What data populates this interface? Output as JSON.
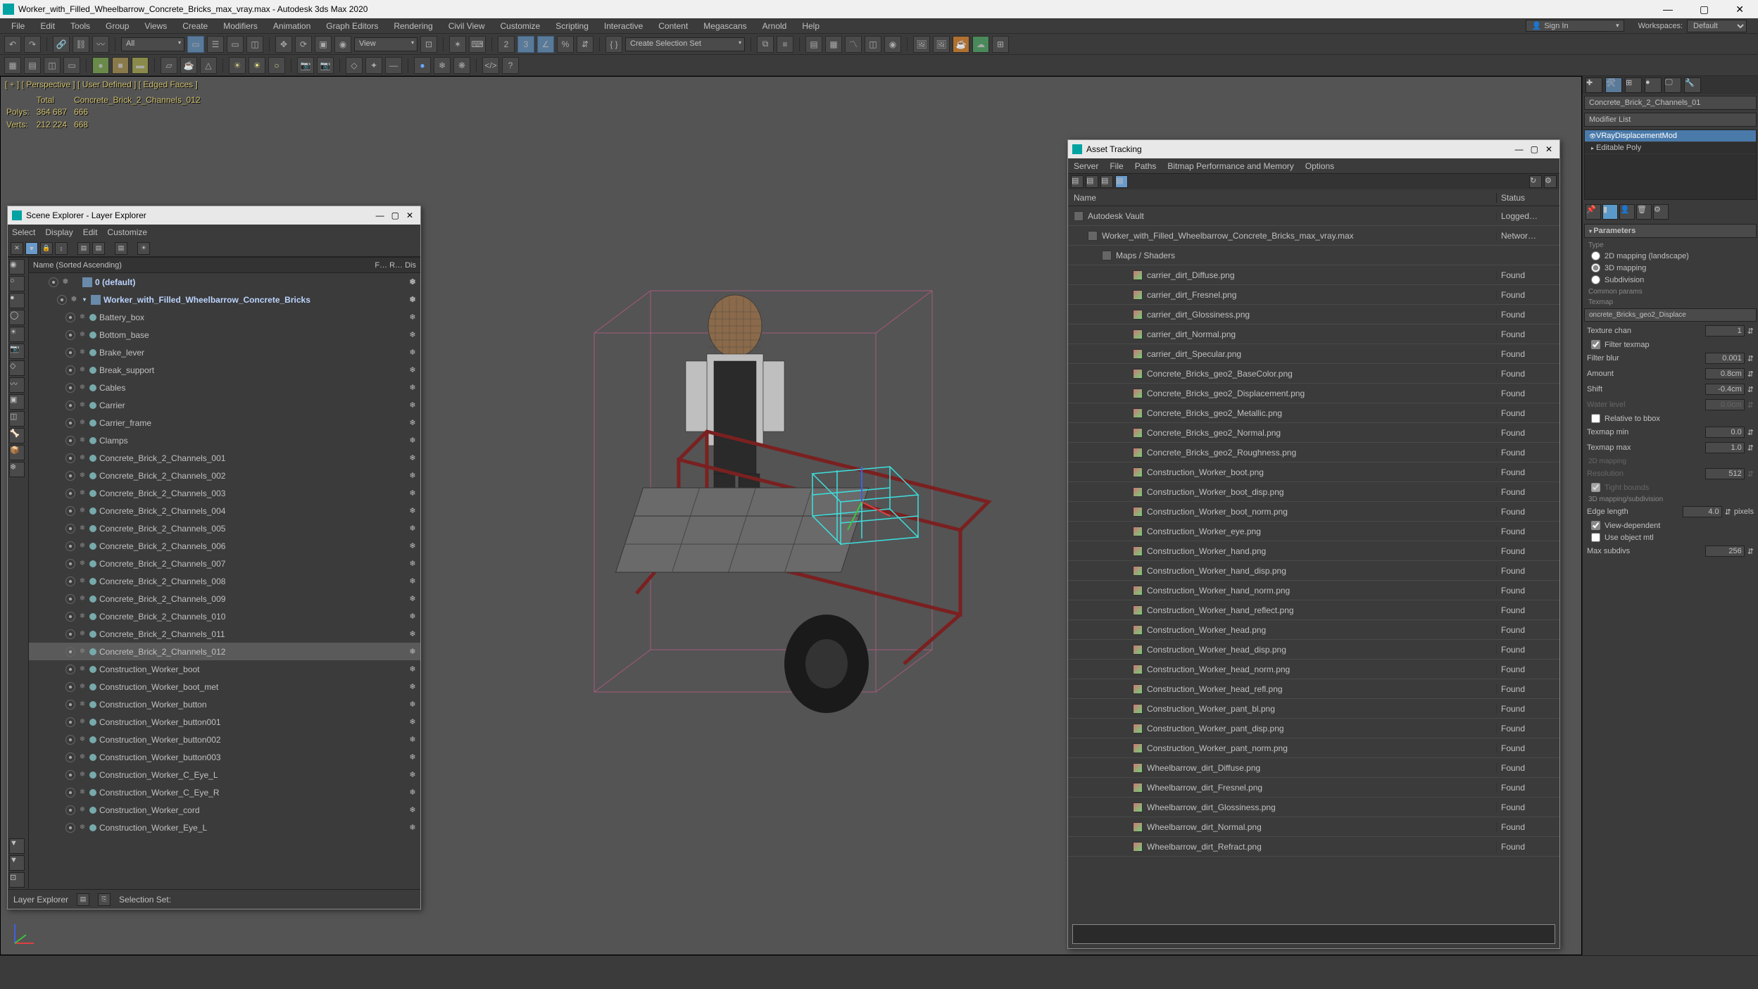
{
  "window": {
    "title": "Worker_with_Filled_Wheelbarrow_Concrete_Bricks_max_vray.max - Autodesk 3ds Max 2020",
    "min": "—",
    "max": "▢",
    "close": "✕"
  },
  "menu": [
    "File",
    "Edit",
    "Tools",
    "Group",
    "Views",
    "Create",
    "Modifiers",
    "Animation",
    "Graph Editors",
    "Rendering",
    "Civil View",
    "Customize",
    "Scripting",
    "Interactive",
    "Content",
    "Megascans",
    "Arnold",
    "Help"
  ],
  "sign_in": "Sign In",
  "workspace_label": "Workspaces:",
  "workspace_value": "Default",
  "sel_dropdown_1": "All",
  "sel_dropdown_2": "View",
  "sel_set_label": "Create Selection Set",
  "viewport": {
    "label": "[ + ] [ Perspective ] [ User Defined ] [ Edged Faces ]",
    "total_label": "Total",
    "obj_name": "Concrete_Brick_2_Channels_012",
    "polys_label": "Polys:",
    "polys_total": "364 687",
    "polys_sel": "666",
    "verts_label": "Verts:",
    "verts_total": "212 224",
    "verts_sel": "668"
  },
  "scene_explorer": {
    "title": "Scene Explorer - Layer Explorer",
    "menu": [
      "Select",
      "Display",
      "Edit",
      "Customize"
    ],
    "header_name": "Name (Sorted Ascending)",
    "header_cols": "F…   R…    Dis",
    "default_layer": "0 (default)",
    "main_layer": "Worker_with_Filled_Wheelbarrow_Concrete_Bricks",
    "objects": [
      "Battery_box",
      "Bottom_base",
      "Brake_lever",
      "Break_support",
      "Cables",
      "Carrier",
      "Carrier_frame",
      "Clamps",
      "Concrete_Brick_2_Channels_001",
      "Concrete_Brick_2_Channels_002",
      "Concrete_Brick_2_Channels_003",
      "Concrete_Brick_2_Channels_004",
      "Concrete_Brick_2_Channels_005",
      "Concrete_Brick_2_Channels_006",
      "Concrete_Brick_2_Channels_007",
      "Concrete_Brick_2_Channels_008",
      "Concrete_Brick_2_Channels_009",
      "Concrete_Brick_2_Channels_010",
      "Concrete_Brick_2_Channels_011",
      "Concrete_Brick_2_Channels_012",
      "Construction_Worker_boot",
      "Construction_Worker_boot_met",
      "Construction_Worker_button",
      "Construction_Worker_button001",
      "Construction_Worker_button002",
      "Construction_Worker_button003",
      "Construction_Worker_C_Eye_L",
      "Construction_Worker_C_Eye_R",
      "Construction_Worker_cord",
      "Construction_Worker_Eye_L"
    ],
    "selected_index": 19,
    "status_label": "Layer Explorer",
    "sel_set_label": "Selection Set:"
  },
  "asset_tracking": {
    "title": "Asset Tracking",
    "tabs": [
      "Server",
      "File",
      "Paths",
      "Bitmap Performance and Memory",
      "Options"
    ],
    "hdr_name": "Name",
    "hdr_status": "Status",
    "vault": {
      "name": "Autodesk Vault",
      "status": "Logged…"
    },
    "scene": {
      "name": "Worker_with_Filled_Wheelbarrow_Concrete_Bricks_max_vray.max",
      "status": "Networ…"
    },
    "maps_label": "Maps / Shaders",
    "assets": [
      {
        "n": "carrier_dirt_Diffuse.png",
        "s": "Found"
      },
      {
        "n": "carrier_dirt_Fresnel.png",
        "s": "Found"
      },
      {
        "n": "carrier_dirt_Glossiness.png",
        "s": "Found"
      },
      {
        "n": "carrier_dirt_Normal.png",
        "s": "Found"
      },
      {
        "n": "carrier_dirt_Specular.png",
        "s": "Found"
      },
      {
        "n": "Concrete_Bricks_geo2_BaseColor.png",
        "s": "Found"
      },
      {
        "n": "Concrete_Bricks_geo2_Displacement.png",
        "s": "Found"
      },
      {
        "n": "Concrete_Bricks_geo2_Metallic.png",
        "s": "Found"
      },
      {
        "n": "Concrete_Bricks_geo2_Normal.png",
        "s": "Found"
      },
      {
        "n": "Concrete_Bricks_geo2_Roughness.png",
        "s": "Found"
      },
      {
        "n": "Construction_Worker_boot.png",
        "s": "Found"
      },
      {
        "n": "Construction_Worker_boot_disp.png",
        "s": "Found"
      },
      {
        "n": "Construction_Worker_boot_norm.png",
        "s": "Found"
      },
      {
        "n": "Construction_Worker_eye.png",
        "s": "Found"
      },
      {
        "n": "Construction_Worker_hand.png",
        "s": "Found"
      },
      {
        "n": "Construction_Worker_hand_disp.png",
        "s": "Found"
      },
      {
        "n": "Construction_Worker_hand_norm.png",
        "s": "Found"
      },
      {
        "n": "Construction_Worker_hand_reflect.png",
        "s": "Found"
      },
      {
        "n": "Construction_Worker_head.png",
        "s": "Found"
      },
      {
        "n": "Construction_Worker_head_disp.png",
        "s": "Found"
      },
      {
        "n": "Construction_Worker_head_norm.png",
        "s": "Found"
      },
      {
        "n": "Construction_Worker_head_refl.png",
        "s": "Found"
      },
      {
        "n": "Construction_Worker_pant_bl.png",
        "s": "Found"
      },
      {
        "n": "Construction_Worker_pant_disp.png",
        "s": "Found"
      },
      {
        "n": "Construction_Worker_pant_norm.png",
        "s": "Found"
      },
      {
        "n": "Wheelbarrow_dirt_Diffuse.png",
        "s": "Found"
      },
      {
        "n": "Wheelbarrow_dirt_Fresnel.png",
        "s": "Found"
      },
      {
        "n": "Wheelbarrow_dirt_Glossiness.png",
        "s": "Found"
      },
      {
        "n": "Wheelbarrow_dirt_Normal.png",
        "s": "Found"
      },
      {
        "n": "Wheelbarrow_dirt_Refract.png",
        "s": "Found"
      }
    ]
  },
  "command_panel": {
    "obj_name": "Concrete_Brick_2_Channels_01",
    "mod_list_label": "Modifier List",
    "stack": [
      "VRayDisplacementMod",
      "Editable Poly"
    ],
    "rollout": "Parameters",
    "type_label": "Type",
    "type_options": [
      "2D mapping (landscape)",
      "3D mapping",
      "Subdivision"
    ],
    "type_selected": 1,
    "common_label": "Common params",
    "texmap_label": "Texmap",
    "texmap_value": "oncrete_Bricks_geo2_Displace",
    "texture_chan_label": "Texture chan",
    "texture_chan_value": "1",
    "filter_texmap_label": "Filter texmap",
    "filter_texmap_checked": true,
    "filter_blur_label": "Filter blur",
    "filter_blur_value": "0.001",
    "amount_label": "Amount",
    "amount_value": "0.8cm",
    "shift_label": "Shift",
    "shift_value": "-0.4cm",
    "water_level_label": "Water level",
    "water_level_value": "0.0cm",
    "rel_bbox_label": "Relative to bbox",
    "rel_bbox_checked": false,
    "texmap_min_label": "Texmap min",
    "texmap_min_value": "0.0",
    "texmap_max_label": "Texmap max",
    "texmap_max_value": "1.0",
    "mapping2d_label": "2D mapping",
    "resolution_label": "Resolution",
    "resolution_value": "512",
    "tight_bounds_label": "Tight bounds",
    "tight_bounds_checked": true,
    "mapping3d_label": "3D mapping/subdivision",
    "edge_len_label": "Edge length",
    "edge_len_value": "4.0",
    "edge_len_unit": "pixels",
    "view_dep_label": "View-dependent",
    "view_dep_checked": true,
    "use_obj_mtl_label": "Use object mtl",
    "use_obj_mtl_checked": false,
    "max_subdivs_label": "Max subdivs",
    "max_subdivs_value": "256"
  }
}
